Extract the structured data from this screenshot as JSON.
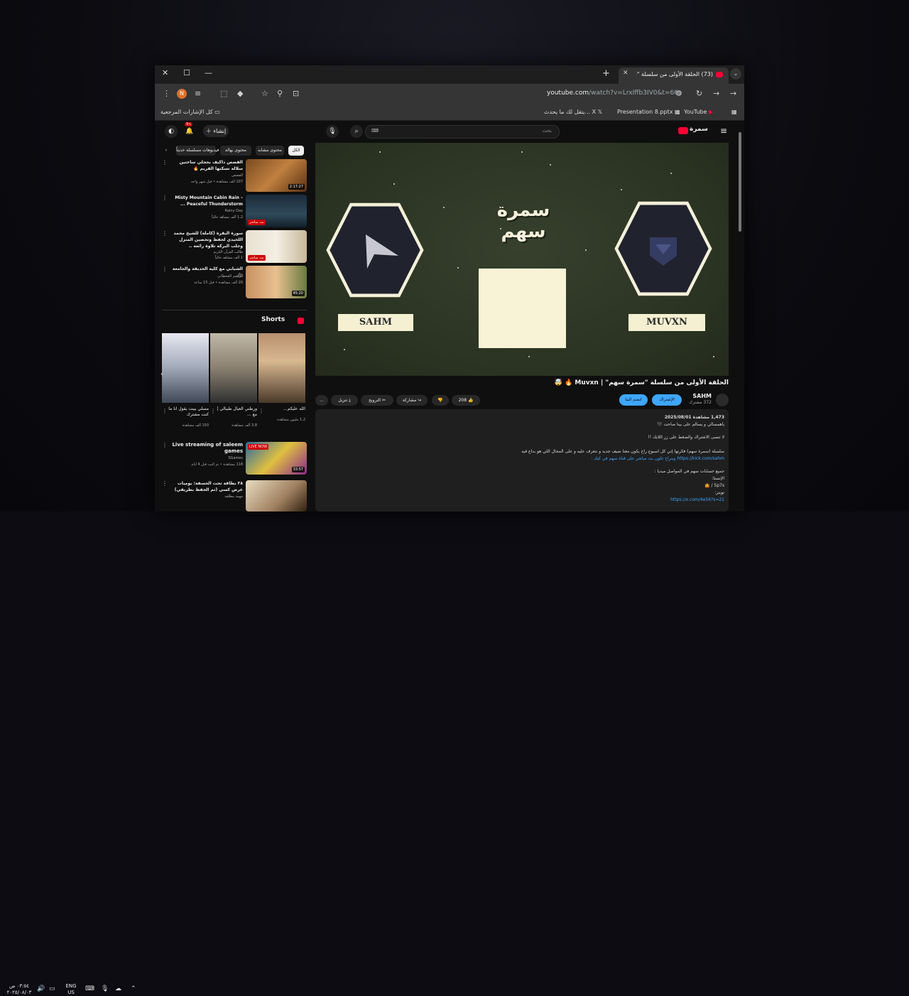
{
  "browser": {
    "tab_title": "(73) الحلقة الأولى من سلسلة \"سـ...",
    "url_host": "youtube.com",
    "url_path": "/watch?v=LrxIffb3IV0&t=66s",
    "profile_initial": "N",
    "bookmarks": {
      "all": "كل الإشارات المرجعية",
      "youtube": "YouTube",
      "presentation": "Presentation 8.pptx",
      "x": "يتقل لك ما يحدث... X"
    }
  },
  "yt": {
    "search_placeholder": "بحث",
    "create": "إنشاء",
    "notif_count": "9+",
    "logo_text": "سمرة"
  },
  "player": {
    "logo": "سمرة سهم",
    "left_name": "SAHM",
    "right_name": "MUVXN"
  },
  "video": {
    "title": "الحلقة الأولى من سلسلة \"سمرة سهم\" | Muvxn 🔥 🤯",
    "channel": "SAHM",
    "subs": "372 مشترك",
    "join": "الإشتراك",
    "subscribe": "انضم الينا",
    "likes": "208",
    "share": "مشاركة",
    "clip": "الترويج",
    "download": "تنزيل",
    "more": "..."
  },
  "description": {
    "lines": [
      "1,473 مشاهدة  2025/08/01",
      "ياهمسالي و يسالم على بينا صاحت 🖤",
      "لا تنسى الاشتراك والضغط على زر اللايك !!",
      "سلسلة (سمرة سهم) فكرتها إني كل اسبوع راح يكون معنا ضيف جديد و نتعرف عليه و على المجال اللي هو بداع فيه",
      "https://kick.com/sahm وبنراح تكون بث مباشر على قناة سهم في كيك :",
      "جميع حسابات سهم في المواصل ميديا :",
      "الإنستا:",
      "5p7s / 🤷",
      "تويتر:",
      "https://x.com/4e56?s=21"
    ]
  },
  "sidebar": {
    "chips": [
      "الكل",
      "محتوى مشابه",
      "محتوى بهالة",
      "فيديوهات مسلسلة حديثاً"
    ],
    "recs": [
      {
        "title": "القصص داكيف بحجلي ساختين سلالة تسكتها القريم 🔥",
        "channel": "القصص",
        "meta": "107 ألف مشاهدة • قبل شهر واحد",
        "dur": "2:17:27",
        "badge": ""
      },
      {
        "title": "Misty Mountain Cabin Rain – Peaceful Thunderstorm ...",
        "channel": "Rainy Day",
        "meta": "1.2 ألف مشاهد حالياً",
        "dur": "",
        "badge": "بث مباشر"
      },
      {
        "title": "سورة البقرة (كاملة) للشيخ محمد اللحيدي لحفظ وتحصين المنزل وجلب البركة تلاوة رائعة ..",
        "channel": "طالب القرآن الكريم",
        "meta": "1 ألف مشاهد حالياً",
        "dur": "",
        "badge": "بث مباشر"
      },
      {
        "title": "الشيابي مع كلية الحديقة والجامعة 🎥",
        "channel": "ابراهيم القحطاني",
        "meta": "20 ألف مشاهدة • قبل 15 ساعة",
        "dur": "45:20",
        "badge": ""
      }
    ],
    "shorts_title": "Shorts",
    "shorts": [
      {
        "title": "الله عليكم...",
        "views": "1.2 مليون مشاهدة"
      },
      {
        "title": "ورطني العيال طيبالي | مع ...",
        "views": "3.8 ألف مشاهدة"
      },
      {
        "title": "مسلي بيبت يقول انا ما كنت مشترك",
        "views": "150 ألف مشاهدة"
      }
    ],
    "recs2": [
      {
        "title": "Live streaming of saleem games",
        "channel": "SGames",
        "meta": "118 مشاهدة • تم البث قبل 4 أيام",
        "dur": "33:57",
        "badge": "LIVE NOW"
      },
      {
        "title": "٣٨ بطاقة تحت الحسفة: يوميات عرض كسي (تم الحفظ بطريقي)",
        "channel": "مهمة مطلقة",
        "meta": "",
        "dur": "",
        "badge": ""
      }
    ]
  },
  "taskbar": {
    "lang_line1": "ENG",
    "lang_line2": "US",
    "time": "٠٣:٥٤ ص",
    "date": "٢٠٢٥/٠٨/٠٣"
  }
}
